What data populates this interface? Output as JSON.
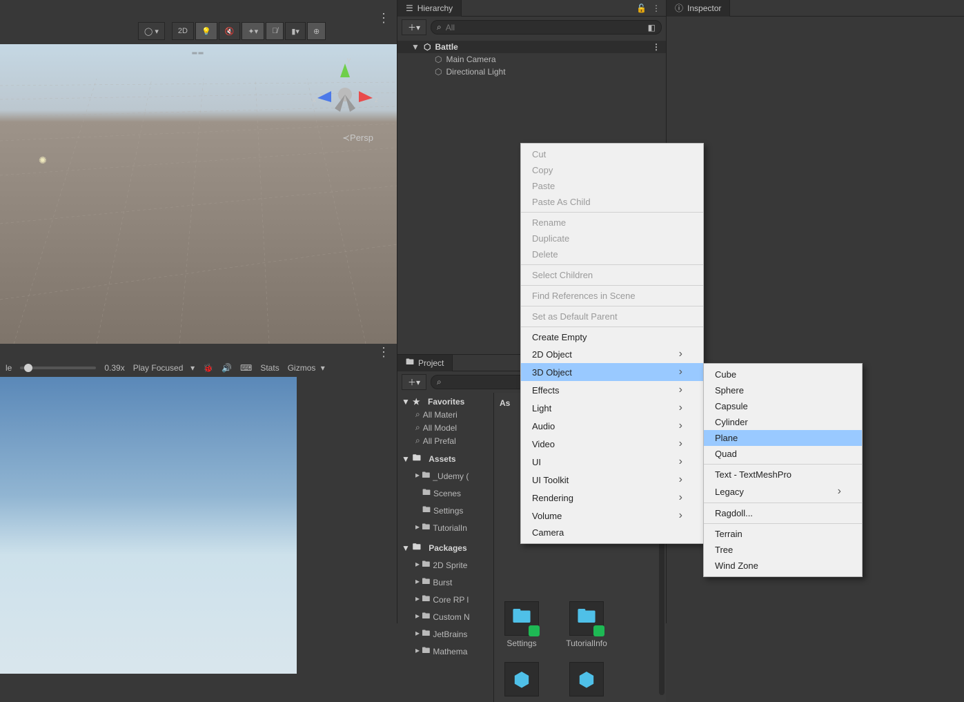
{
  "hierarchy": {
    "tab": "Hierarchy",
    "search_placeholder": "All",
    "scene": "Battle",
    "children": [
      "Main Camera",
      "Directional Light"
    ]
  },
  "inspector": {
    "tab": "Inspector"
  },
  "project": {
    "tab": "Project",
    "favorites_label": "Favorites",
    "favorites": [
      "All Materi",
      "All Model",
      "All Prefal"
    ],
    "assets_label": "Assets",
    "assets_folders": [
      "_Udemy (",
      "Scenes",
      "Settings",
      "TutorialIn"
    ],
    "packages_label": "Packages",
    "packages": [
      "2D Sprite",
      "Burst",
      "Core RP l",
      "Custom N",
      "JetBrains",
      "Mathema"
    ],
    "asset_panel_header": "As",
    "asset_items": [
      "Settings",
      "TutorialInfo"
    ]
  },
  "scene_toolbar": {
    "btn_2d": "2D",
    "persp_label": "Persp",
    "axis_x": "x",
    "axis_y": "y",
    "axis_z": "z"
  },
  "game_toolbar": {
    "scale_label": "le",
    "scale_value": "0.39x",
    "play_mode": "Play Focused",
    "stats": "Stats",
    "gizmos": "Gizmos"
  },
  "context_menu": {
    "items": [
      {
        "label": "Cut",
        "type": "disabled"
      },
      {
        "label": "Copy",
        "type": "disabled"
      },
      {
        "label": "Paste",
        "type": "disabled"
      },
      {
        "label": "Paste As Child",
        "type": "disabled"
      },
      {
        "type": "sep"
      },
      {
        "label": "Rename",
        "type": "disabled"
      },
      {
        "label": "Duplicate",
        "type": "disabled"
      },
      {
        "label": "Delete",
        "type": "disabled"
      },
      {
        "type": "sep"
      },
      {
        "label": "Select Children",
        "type": "disabled"
      },
      {
        "type": "sep"
      },
      {
        "label": "Find References in Scene",
        "type": "disabled"
      },
      {
        "type": "sep"
      },
      {
        "label": "Set as Default Parent",
        "type": "disabled"
      },
      {
        "type": "sep"
      },
      {
        "label": "Create Empty",
        "type": "item"
      },
      {
        "label": "2D Object",
        "type": "sub"
      },
      {
        "label": "3D Object",
        "type": "sub-hl"
      },
      {
        "label": "Effects",
        "type": "sub"
      },
      {
        "label": "Light",
        "type": "sub"
      },
      {
        "label": "Audio",
        "type": "sub"
      },
      {
        "label": "Video",
        "type": "sub"
      },
      {
        "label": "UI",
        "type": "sub"
      },
      {
        "label": "UI Toolkit",
        "type": "sub"
      },
      {
        "label": "Rendering",
        "type": "sub"
      },
      {
        "label": "Volume",
        "type": "sub"
      },
      {
        "label": "Camera",
        "type": "item"
      }
    ],
    "submenu_3d": [
      {
        "label": "Cube"
      },
      {
        "label": "Sphere"
      },
      {
        "label": "Capsule"
      },
      {
        "label": "Cylinder"
      },
      {
        "label": "Plane",
        "hl": true
      },
      {
        "label": "Quad"
      },
      {
        "type": "sep"
      },
      {
        "label": "Text - TextMeshPro"
      },
      {
        "label": "Legacy",
        "sub": true
      },
      {
        "type": "sep"
      },
      {
        "label": "Ragdoll..."
      },
      {
        "type": "sep"
      },
      {
        "label": "Terrain"
      },
      {
        "label": "Tree"
      },
      {
        "label": "Wind Zone"
      }
    ]
  }
}
